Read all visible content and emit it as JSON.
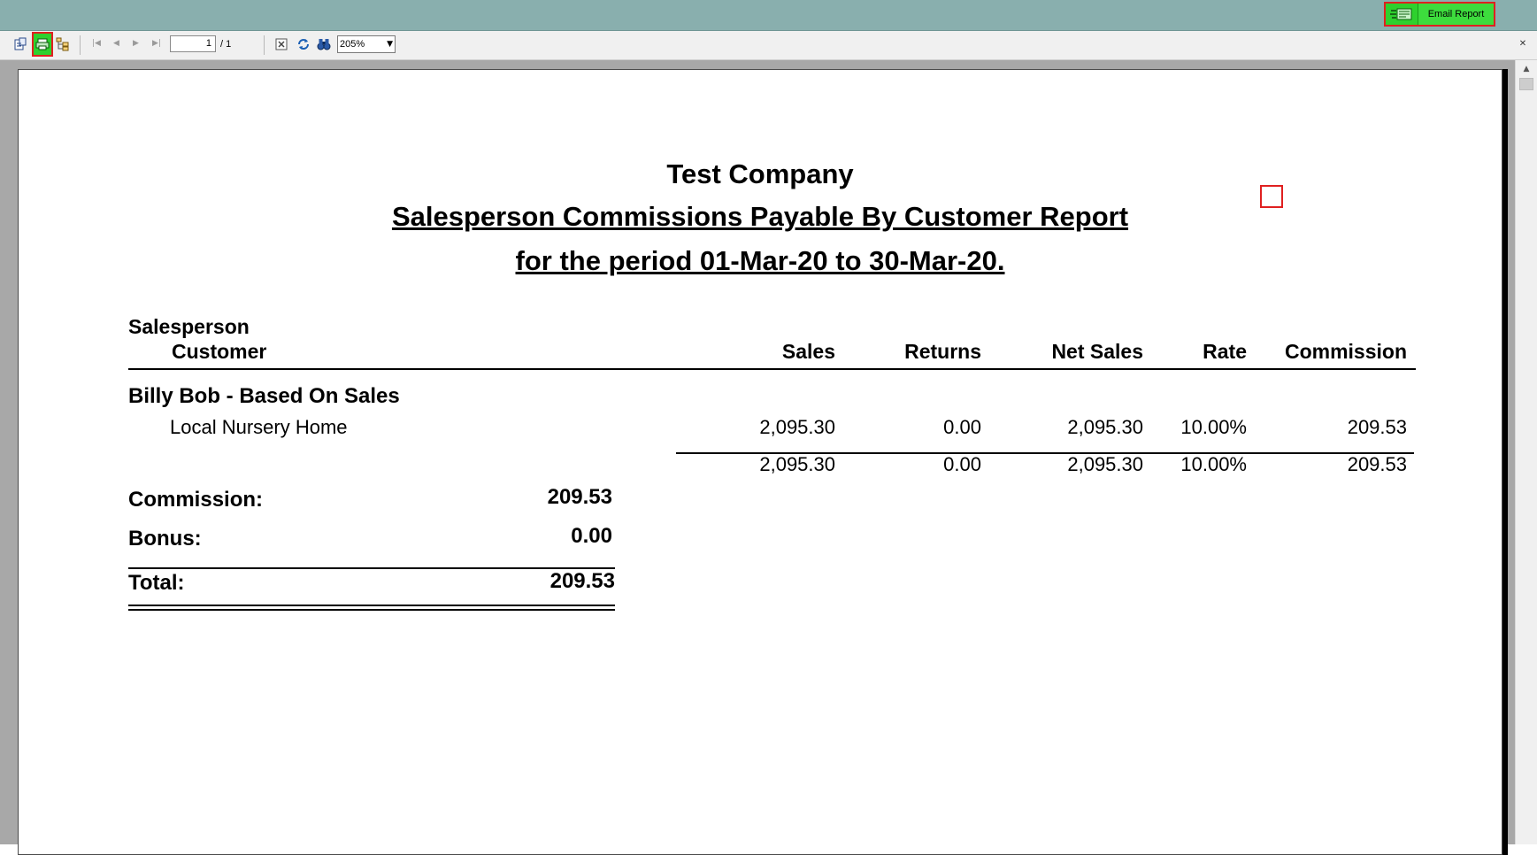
{
  "toolbar": {
    "page_current": "1",
    "page_total": "/ 1",
    "zoom": "205%",
    "email_report_label": "Email Report"
  },
  "report": {
    "company": "Test Company",
    "title": "Salesperson Commissions Payable By Customer Report",
    "period": "for the period 01-Mar-20 to 30-Mar-20.",
    "headers": {
      "salesperson": "Salesperson",
      "customer": "Customer",
      "sales": "Sales",
      "returns": "Returns",
      "net_sales": "Net Sales",
      "rate": "Rate",
      "commission": "Commission"
    },
    "group": {
      "name": "Billy Bob - Based On Sales",
      "rows": [
        {
          "customer": "Local Nursery Home",
          "sales": "2,095.30",
          "returns": "0.00",
          "net_sales": "2,095.30",
          "rate": "10.00%",
          "commission": "209.53"
        }
      ],
      "totals": {
        "sales": "2,095.30",
        "returns": "0.00",
        "net_sales": "2,095.30",
        "rate": "10.00%",
        "commission": "209.53"
      }
    },
    "summary": {
      "commission_label": "Commission:",
      "commission_value": "209.53",
      "bonus_label": "Bonus:",
      "bonus_value": "0.00",
      "total_label": "Total:",
      "total_value": "209.53"
    }
  }
}
